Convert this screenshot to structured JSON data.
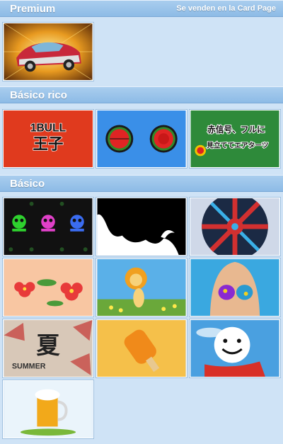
{
  "sections": {
    "premium": {
      "title": "Premium",
      "note": "Se venden en la Card Page"
    },
    "rich": {
      "title": "Básico rico"
    },
    "basic": {
      "title": "Básico"
    }
  },
  "thumbnails": {
    "rich_1bull": {
      "line1": "1BULL",
      "line2": "王子"
    },
    "rich_signal": {
      "line1": "赤信号、フルに",
      "line2": "見立ててエアターツ"
    },
    "basic_summer": {
      "kanji": "夏",
      "word": "SUMMER"
    }
  },
  "colors": {
    "page_bg": "#cfe3f6",
    "header_bg": "#9cc6ec",
    "header_text": "#ffffff"
  }
}
